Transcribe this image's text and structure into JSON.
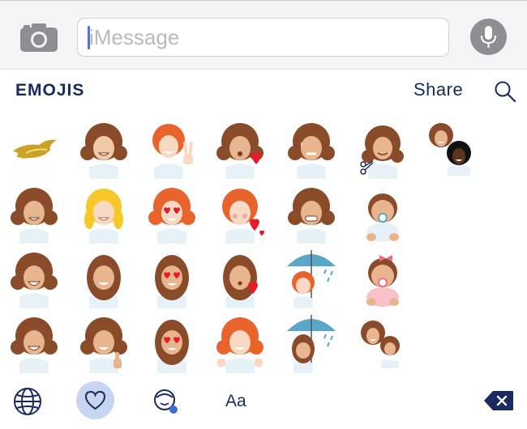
{
  "message_bar": {
    "placeholder": "iMessage",
    "camera_icon": "camera-icon",
    "mic_icon": "microphone-icon"
  },
  "header": {
    "title": "EMOJIS",
    "share_label": "Share",
    "search_icon": "search-icon"
  },
  "emoji_grid": [
    {
      "row": 1,
      "items": [
        "gold-dove-logo",
        "curly-brown-hair-woman",
        "curly-red-hair-woman-peace-sign",
        "curly-brown-hair-woman-heart",
        "curly-brown-hair-woman-sweat",
        "curly-brown-hair-woman-scissors",
        "two-women-curly-hair"
      ]
    },
    {
      "row": 2,
      "items": [
        "curly-brown-hair-woman-smile",
        "blonde-woman",
        "red-hair-woman-heart-eyes",
        "red-hair-woman-blush-hearts",
        "curly-brown-hair-woman-grimace",
        "baby-with-pacifier"
      ]
    },
    {
      "row": 3,
      "items": [
        "curly-brown-hair-woman-grin",
        "wavy-brown-hair-woman",
        "wavy-brown-hair-woman-heart-eyes",
        "wavy-brown-hair-woman-kiss",
        "red-hair-woman-umbrella-rain",
        "baby-girl-pink-bow"
      ]
    },
    {
      "row": 4,
      "items": [
        "curly-brown-hair-woman-laugh",
        "curly-brown-hair-woman-thumbs-up",
        "wavy-brown-hair-woman-heart-eyes-2",
        "red-hair-woman-shrug",
        "brown-hair-woman-umbrella-rain",
        "mother-and-child"
      ]
    }
  ],
  "bottom_bar": {
    "globe_icon": "globe-icon",
    "heart_icon": "heart-icon",
    "face_icon": "face-icon",
    "text_label": "Aa",
    "delete_icon": "delete-icon"
  },
  "colors": {
    "brand_navy": "#1b2a5e",
    "brown_hair": "#8a4b2a",
    "red_hair": "#e8642c",
    "blonde_hair": "#f6c829",
    "skin": "#f0c9a6",
    "shirt": "#e6f2f8",
    "heart_red": "#e41c2b",
    "umbrella_blue": "#5aa6c7",
    "gold": "#c9a227",
    "heart_button_bg": "#c7d5f0"
  }
}
